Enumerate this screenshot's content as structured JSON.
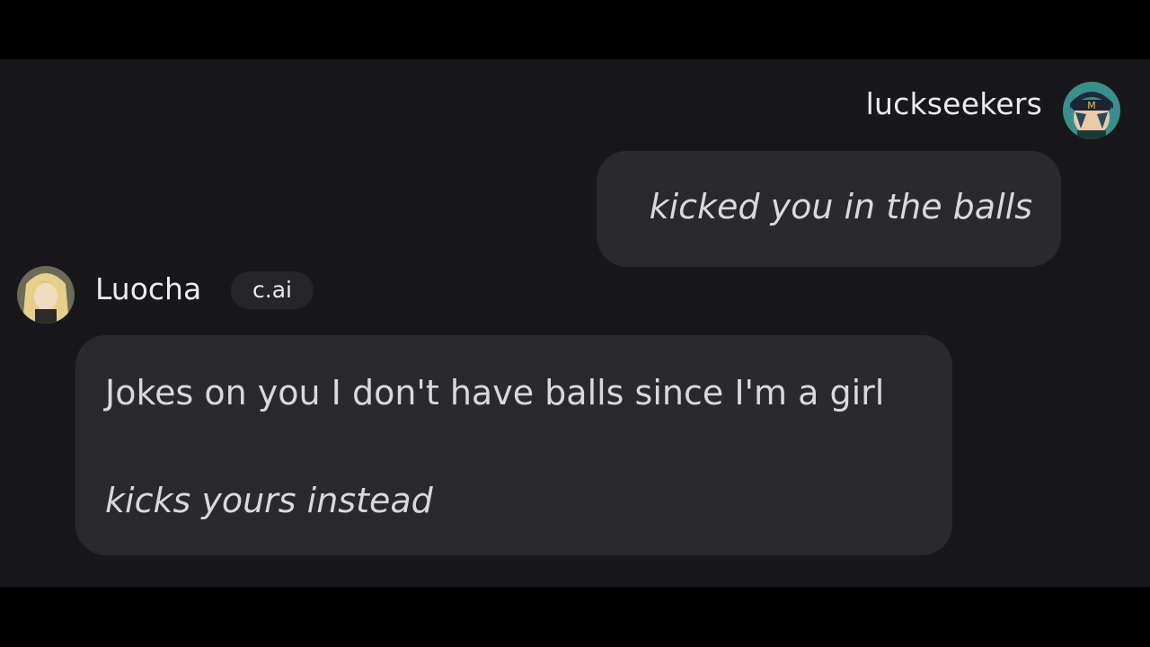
{
  "user": {
    "name": "luckseekers",
    "avatar_icon": "user-avatar-icon",
    "message": "kicked you in the balls"
  },
  "bot": {
    "name": "Luocha",
    "badge": "c.ai",
    "avatar_icon": "bot-avatar-icon",
    "message_line1": "Jokes on you I don't have balls since I'm a girl",
    "message_line2": "kicks yours instead"
  },
  "colors": {
    "background": "#18181b",
    "bubble": "#2a2a2e",
    "letterbox": "#000000"
  }
}
